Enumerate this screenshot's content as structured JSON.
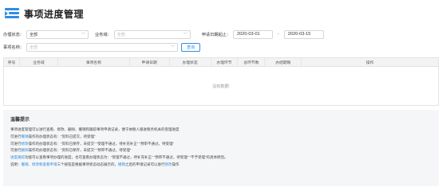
{
  "header": {
    "title": "事项进度管理"
  },
  "filters": {
    "row1": {
      "office_label": "办理状态：",
      "office_value": "全部",
      "type_label": "业务域：",
      "type_placeholder": "全部",
      "date_label": "申请日期起止：",
      "date_from": "2020-03-01",
      "date_sep": "-",
      "date_to": "2020-03-15"
    },
    "row2": {
      "name_label": "事项名称：",
      "name_placeholder": "全部",
      "query_button": "查询"
    }
  },
  "table": {
    "columns": [
      "序号",
      "业务域",
      "事项名称",
      "申请日期",
      "办理状态",
      "办理环节",
      "总环节数",
      "办结期限",
      "操作"
    ],
    "empty_text": "没有数据!"
  },
  "tips": {
    "title": "温馨提示",
    "lines": [
      [
        {
          "t": "事项进度管理可以进行查看、修改、删除、撤销和跟踪事项申请记录，便于纳税人跟进税务机关的受理进度"
        }
      ],
      [
        {
          "t": "可进行"
        },
        {
          "t": "撤销",
          "hl": true
        },
        {
          "t": "操作的办理状态有：“资料已提交，待受理”"
        }
      ],
      [
        {
          "t": "可进行"
        },
        {
          "t": "修改",
          "hl": true
        },
        {
          "t": "操作的办理状态有：“资料已保存，未提交”  “受理不通过，待补充补正”  “预审不通过，待受理”"
        }
      ],
      [
        {
          "t": "可进行"
        },
        {
          "t": "删除",
          "hl": true
        },
        {
          "t": "操作的办理状态有：“资料已保存，未提交”  “预审不通过，待受理”"
        }
      ],
      [
        {
          "t": "进度跟踪",
          "hl": true
        },
        {
          "t": "功能可以查看事项办理的进度，也可查看办理状态为：“受理不通过，待补充补正”  “预审不通过，待受理”  “不予受理”的具体原因。"
        }
      ],
      [
        {
          "t": "说明："
        },
        {
          "t": "撤销、修改和查看申请",
          "hl": true
        },
        {
          "t": "三个按钮是根据事项状态动态展示的，"
        },
        {
          "t": "撤销",
          "hl": true
        },
        {
          "t": "之后的申请记录可以进行"
        },
        {
          "t": "修改",
          "hl": true
        },
        {
          "t": "操作"
        }
      ]
    ]
  },
  "colors": {
    "accent": "#2f8de4",
    "tips_bg": "#f5f6f8",
    "table_header_bg": "#f2f3f5"
  }
}
